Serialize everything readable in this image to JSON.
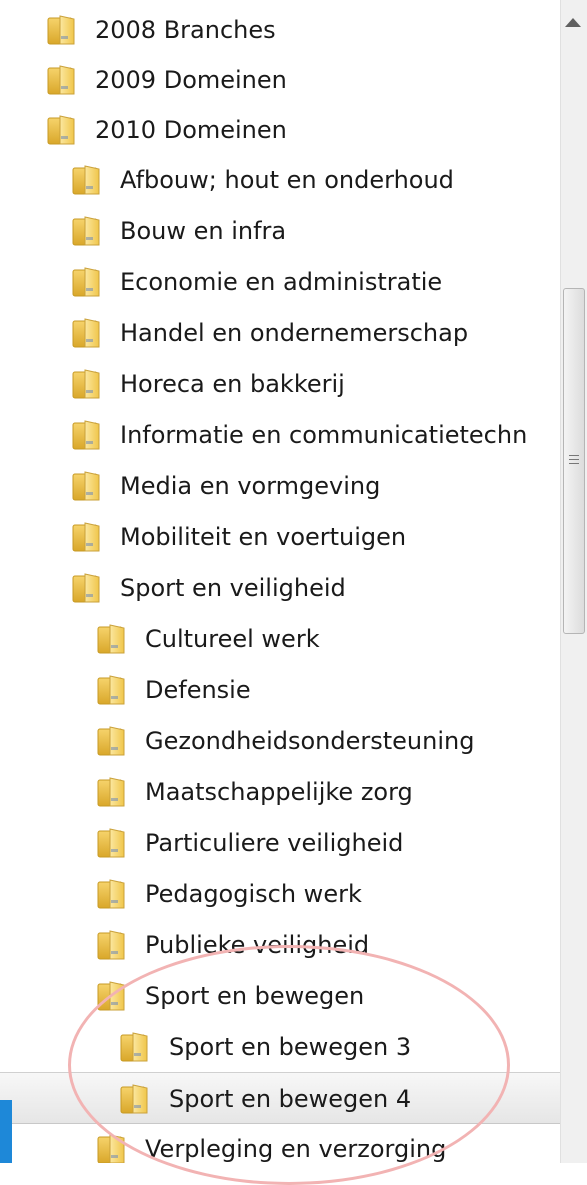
{
  "tree": {
    "items": [
      {
        "label": "2008 Branches",
        "icon": "folder-icon"
      },
      {
        "label": "2009 Domeinen",
        "icon": "folder-icon"
      },
      {
        "label": "2010 Domeinen",
        "icon": "folder-icon"
      },
      {
        "label": "Afbouw; hout en onderhoud",
        "icon": "folder-icon"
      },
      {
        "label": "Bouw en infra",
        "icon": "folder-icon"
      },
      {
        "label": "Economie en administratie",
        "icon": "folder-icon"
      },
      {
        "label": "Handel en ondernemerschap",
        "icon": "folder-icon"
      },
      {
        "label": "Horeca en bakkerij",
        "icon": "folder-icon"
      },
      {
        "label": "Informatie en communicatietechn",
        "icon": "folder-icon"
      },
      {
        "label": "Media en vormgeving",
        "icon": "folder-icon"
      },
      {
        "label": "Mobiliteit en voertuigen",
        "icon": "folder-icon"
      },
      {
        "label": "Sport en veiligheid",
        "icon": "folder-icon"
      },
      {
        "label": "Cultureel werk",
        "icon": "folder-icon"
      },
      {
        "label": "Defensie",
        "icon": "folder-icon"
      },
      {
        "label": "Gezondheidsondersteuning",
        "icon": "folder-icon"
      },
      {
        "label": "Maatschappelijke zorg",
        "icon": "folder-icon"
      },
      {
        "label": "Particuliere veiligheid",
        "icon": "folder-icon"
      },
      {
        "label": "Pedagogisch werk",
        "icon": "folder-icon"
      },
      {
        "label": "Publieke veiligheid",
        "icon": "folder-icon"
      },
      {
        "label": "Sport en bewegen",
        "icon": "folder-icon"
      },
      {
        "label": "Sport en bewegen 3",
        "icon": "folder-icon"
      },
      {
        "label": "Sport en bewegen 4",
        "icon": "folder-icon",
        "selected": true
      },
      {
        "label": "Verpleging en verzorging",
        "icon": "folder-icon"
      }
    ]
  },
  "scrollbar": {
    "up_arrow_icon": "chevron-up-icon",
    "grip_icon": "grip-icon"
  },
  "colors": {
    "highlight_circle": "#f2b3b3",
    "selection_bg": "#e9e9e9",
    "accent_edge": "#1e88d8",
    "folder": "#f0c64a"
  }
}
